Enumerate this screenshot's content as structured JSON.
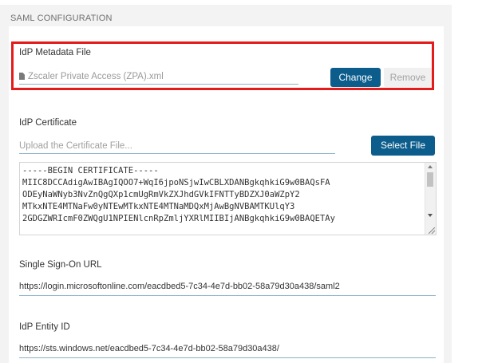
{
  "section": {
    "title": "SAML CONFIGURATION"
  },
  "idp_metadata": {
    "label": "IdP Metadata File",
    "filename": "Zscaler Private Access (ZPA).xml",
    "change_label": "Change",
    "remove_label": "Remove"
  },
  "idp_certificate": {
    "label": "IdP Certificate",
    "placeholder": "Upload the Certificate File...",
    "select_label": "Select File",
    "lines": [
      "-----BEGIN CERTIFICATE-----",
      "MIIC8DCCAdigAwIBAgIQOO7+WqI6jpoNSjwIwCBLXDANBgkqhkiG9w0BAQsFA",
      "ODEyNaWNyb3NvZnQgQXp1cmUgRmVkZXJhdGVkIFNTTyBDZXJ0aWZpY2",
      "MTkxNTE4MTNaFw0yNTEwMTkxNTE4MTNaMDQxMjAwBgNVBAMTKUlqY3",
      "2GDGZWRIcmF0ZWQgU1NPIENlcnRpZmljYXRlMIIBIjANBgkqhkiG9w0BAQETAy"
    ]
  },
  "sso_url": {
    "label": "Single Sign-On URL",
    "value": "https://login.microsoftonline.com/eacdbed5-7c34-4e7d-bb02-58a79d30a438/saml2"
  },
  "entity_id": {
    "label": "IdP Entity ID",
    "value": "https://sts.windows.net/eacdbed5-7c34-4e7d-bb02-58a79d30a438/"
  },
  "colors": {
    "accent": "#0d5d8c",
    "highlight": "#e31b1b"
  }
}
